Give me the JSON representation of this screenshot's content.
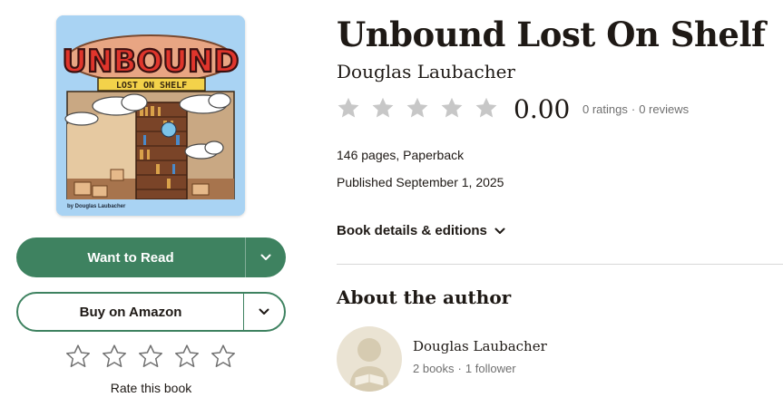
{
  "cover": {
    "title_art": "UNBOUND",
    "subtitle_art": "LOST ON SHELF",
    "byline": "by Douglas Laubacher"
  },
  "actions": {
    "want_to_read": "Want to Read",
    "buy_label": "Buy on Amazon",
    "rate_label": "Rate this book",
    "user_rating": 0
  },
  "book": {
    "title": "Unbound Lost On Shelf",
    "author": "Douglas Laubacher",
    "avg_rating": "0.00",
    "avg_rating_fraction": 0,
    "ratings_count": "0 ratings",
    "reviews_count": "0 reviews",
    "separator": "·",
    "pages_format": "146 pages, Paperback",
    "published": "Published September 1, 2025",
    "details_link": "Book details & editions"
  },
  "about": {
    "heading": "About the author",
    "name": "Douglas Laubacher",
    "books": "2 books",
    "followers": "1 follower"
  },
  "colors": {
    "primary_green": "#3e8260",
    "star_empty": "#c7c7c7",
    "muted_text": "#707070",
    "avatar_bg": "#eae3d3"
  }
}
